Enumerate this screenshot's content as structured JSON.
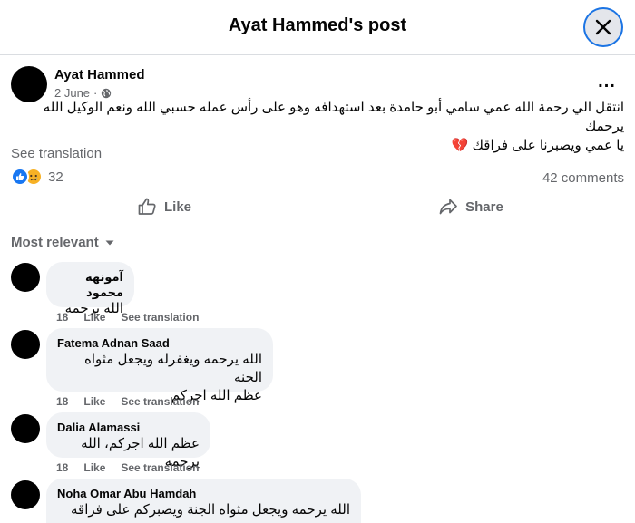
{
  "header": {
    "title": "Ayat Hammed's post",
    "close_icon": "close-icon"
  },
  "post": {
    "author": "Ayat Hammed",
    "date": "2 June",
    "separator": "·",
    "audience_icon": "globe-icon",
    "more_icon": "more-options-icon",
    "more_label": "...",
    "body_lines": [
      "انتقل الي رحمة الله عمي سامي أبو حامدة بعد استهدافه وهو على رأس عمله حسبي الله ونعم الوكيل الله يرحمك",
      "يا عمي ويصبرنا على فراقك"
    ],
    "body_emoji": "💔",
    "see_translation": "See translation",
    "reaction_icons": [
      "like-reaction-icon",
      "sad-reaction-icon"
    ],
    "reaction_count": "32",
    "comments_count": "42 comments"
  },
  "actions": {
    "like_label": "Like",
    "share_label": "Share"
  },
  "sort": {
    "label": "Most relevant",
    "icon": "caret-down-icon"
  },
  "comments": [
    {
      "name": "آمونهه محمود",
      "text": [
        "الله يرحمه"
      ],
      "count": "18",
      "like": "Like",
      "translate": "See translation"
    },
    {
      "name": "Fatema Adnan Saad",
      "text": [
        "الله يرحمه ويغفرله ويجعل مثواه الجنه",
        "عظم الله اجركم"
      ],
      "count": "18",
      "like": "Like",
      "translate": "See translation"
    },
    {
      "name": "Dalia Alamassi",
      "text": [
        "عظم الله اجركم، الله يرحمه"
      ],
      "count": "18",
      "like": "Like",
      "translate": "See translation"
    },
    {
      "name": "Noha Omar Abu Hamdah",
      "text": [
        "الله يرحمه ويجعل مثواه الجنة ويصبركم على فراقه"
      ],
      "count": "",
      "like": "",
      "translate": ""
    }
  ],
  "colors": {
    "accent": "#1877f2",
    "secondary_text": "#65676b",
    "bubble_bg": "#f0f2f5",
    "heart": "#c0392b"
  }
}
